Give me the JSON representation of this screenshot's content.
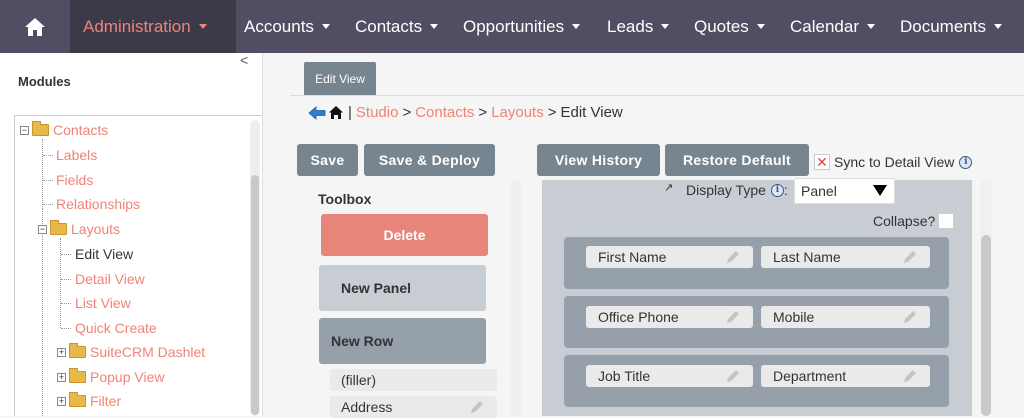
{
  "nav": {
    "admin_label": "Administration",
    "items": [
      {
        "label": "Accounts"
      },
      {
        "label": "Contacts"
      },
      {
        "label": "Opportunities"
      },
      {
        "label": "Leads"
      },
      {
        "label": "Quotes"
      },
      {
        "label": "Calendar"
      },
      {
        "label": "Documents"
      }
    ]
  },
  "sidebar": {
    "collapse_glyph": "<",
    "title": "Modules",
    "tree": {
      "contacts": "Contacts",
      "labels": "Labels",
      "fields": "Fields",
      "relationships": "Relationships",
      "layouts": "Layouts",
      "edit_view": "Edit View",
      "detail_view": "Detail View",
      "list_view": "List View",
      "quick_create": "Quick Create",
      "suitecrm_dashlet": "SuiteCRM Dashlet",
      "popup_view": "Popup View",
      "filter": "Filter"
    }
  },
  "main": {
    "tab_label": "Edit View",
    "breadcrumb": {
      "studio": "Studio",
      "contacts": "Contacts",
      "layouts": "Layouts",
      "current": "Edit View",
      "separator": ">",
      "pipe": "|"
    },
    "buttons": {
      "save": "Save",
      "save_deploy": "Save & Deploy",
      "view_history": "View History",
      "restore_default": "Restore Default"
    },
    "sync_label": "Sync to Detail View",
    "sync_checked_glyph": "✕",
    "info_glyph": "i"
  },
  "toolbox": {
    "title": "Toolbox",
    "delete": "Delete",
    "new_panel": "New Panel",
    "new_row": "New Row",
    "fields": [
      "(filler)",
      "Address"
    ]
  },
  "layout": {
    "display_type_label": "Display Type",
    "display_type_colon": ":",
    "display_type_value": "Panel",
    "collapse_label": "Collapse?",
    "rows": [
      [
        "First Name",
        "Last Name"
      ],
      [
        "Office Phone",
        "Mobile"
      ],
      [
        "Job Title",
        "Department"
      ]
    ]
  },
  "colors": {
    "nav_bg": "#534d64",
    "accent": "#f08377",
    "button_bg": "#778591",
    "panel_bg": "#c8cdd3",
    "row_bg": "#95a0ab"
  }
}
